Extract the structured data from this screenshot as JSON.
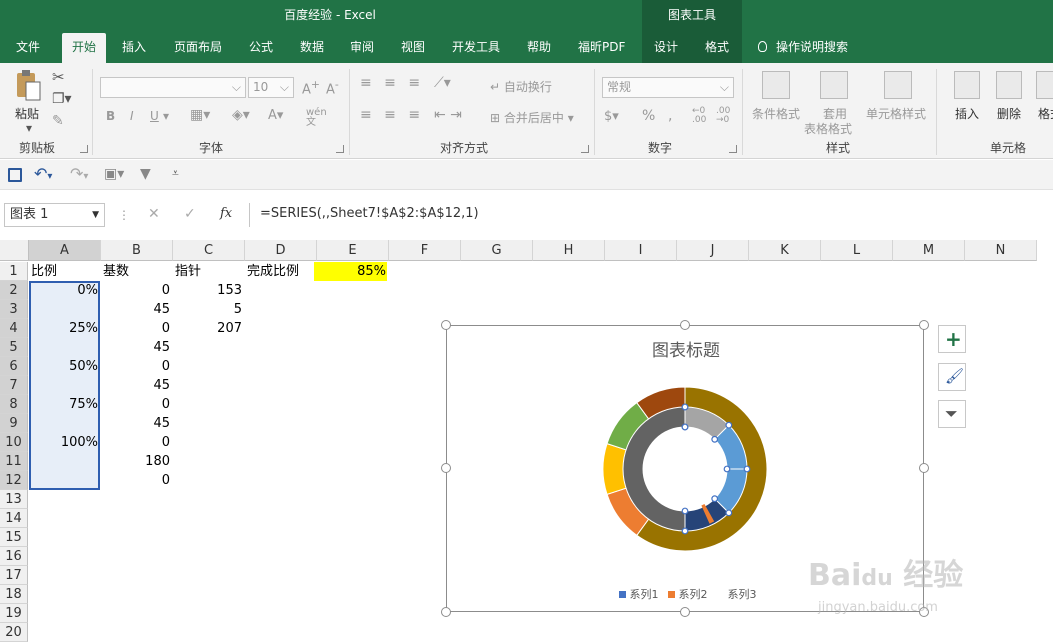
{
  "app": {
    "window_title": "百度经验  -  Excel",
    "context_tab_group": "图表工具"
  },
  "tabs": [
    "文件",
    "开始",
    "插入",
    "页面布局",
    "公式",
    "数据",
    "审阅",
    "视图",
    "开发工具",
    "帮助",
    "福昕PDF",
    "设计",
    "格式"
  ],
  "tell_me": "操作说明搜索",
  "ribbon": {
    "clipboard": {
      "paste": "粘贴",
      "label": "剪贴板"
    },
    "font": {
      "size": "10",
      "bold": "B",
      "italic": "I",
      "underline": "U",
      "label": "字体"
    },
    "alignment": {
      "wrap": "自动换行",
      "merge": "合并后居中",
      "label": "对齐方式"
    },
    "number": {
      "format": "常规",
      "label": "数字"
    },
    "styles": {
      "conditional": "条件格式",
      "table_fmt_1": "套用",
      "table_fmt_2": "表格格式",
      "cell_styles": "单元格样式",
      "label": "样式"
    },
    "cells": {
      "insert": "插入",
      "delete": "删除",
      "format": "格式",
      "label": "单元格"
    }
  },
  "formula_bar": {
    "name_box": "图表 1",
    "fx": "fx",
    "formula": "=SERIES(,,Sheet7!$A$2:$A$12,1)"
  },
  "columns": [
    "A",
    "B",
    "C",
    "D",
    "E",
    "F",
    "G",
    "H",
    "I",
    "J",
    "K",
    "L",
    "M",
    "N"
  ],
  "rows": [
    "1",
    "2",
    "3",
    "4",
    "5",
    "6",
    "7",
    "8",
    "9",
    "10",
    "11",
    "12",
    "13",
    "14",
    "15",
    "16",
    "17",
    "18",
    "19",
    "20"
  ],
  "cells": {
    "A1": "比例",
    "B1": "基数",
    "C1": "指针",
    "D1": "完成比例",
    "E1": "85%",
    "A2": "0%",
    "B2": "0",
    "C2": "153",
    "B3": "45",
    "C3": "5",
    "A4": "25%",
    "B4": "0",
    "C4": "207",
    "B5": "45",
    "A6": "50%",
    "B6": "0",
    "B7": "45",
    "A8": "75%",
    "B8": "0",
    "B9": "45",
    "A10": "100%",
    "B10": "0",
    "B11": "180",
    "B12": "0"
  },
  "colors": {
    "excel_green": "#217346",
    "highlight_yellow": "#ffff00",
    "selection_fill": "#e7eef8",
    "selection_border": "#2f5eb0"
  },
  "chart": {
    "title": "图表标题",
    "legend": [
      "系列1",
      "系列2",
      "系列3"
    ],
    "legend_colors": [
      "#4472c4",
      "#ed7d31",
      "#a5a5a5"
    ]
  },
  "chart_data": {
    "type": "doughnut",
    "title": "图表标题",
    "legend_entries": [
      "系列1",
      "系列2",
      "系列3"
    ],
    "rings": [
      {
        "ring": "outer",
        "values": [
          270,
          45,
          45,
          45,
          45
        ],
        "colors": [
          "#997300",
          "#ed7d31",
          "#ffc000",
          "#70ad47",
          "#9e480e"
        ]
      },
      {
        "ring": "middle",
        "values": [
          0,
          45,
          0,
          45,
          0,
          45,
          0,
          45,
          0,
          180,
          0
        ],
        "colors": [
          "#a5a5a5",
          "#a5a5a5",
          "#5b9bd5",
          "#5b9bd5",
          "#5b9bd5",
          "#5b9bd5",
          "#264478",
          "#264478",
          "#264478",
          "#636363",
          "#636363"
        ]
      },
      {
        "ring": "pointer",
        "values": [
          153,
          5,
          207
        ],
        "colors": [
          "none",
          "#ed7d31",
          "none"
        ]
      }
    ]
  },
  "watermark": "Baidu经验 jingyan.baidu.com"
}
